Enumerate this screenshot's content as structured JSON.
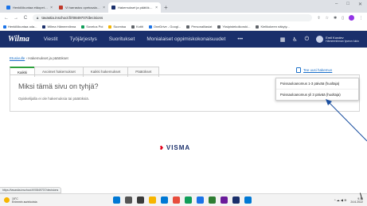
{
  "browser": {
    "tabs": [
      {
        "title": "Henkilökuntaa etäopetus ja oppimi...",
        "color": "#1a73e8"
      },
      {
        "title": "Vi harrastus opetusalaltaan (P)...",
        "color": "#c0392b"
      },
      {
        "title": "Hakemukset ja päätökset - Wilm...",
        "color": "#1a2f6b",
        "active": true
      }
    ],
    "new_tab_icon": "+",
    "window_controls": [
      "–",
      "□",
      "✕"
    ],
    "nav": {
      "back": "←",
      "forward": "→",
      "reload": "C"
    },
    "url": "tavastia.inschool.fi/!0849707/decisions",
    "bookmarks": [
      {
        "label": "Henkilökuntaa oda...",
        "color": "#1a73e8"
      },
      {
        "label": "Wilma Hämeenlinna",
        "color": "#1a2f6b"
      },
      {
        "label": "Sovelus Poi",
        "color": "#0f9d58"
      },
      {
        "label": "Suomisa",
        "color": "#f4b400"
      },
      {
        "label": "Kotiti",
        "color": "#5f6368"
      },
      {
        "label": "OneDrive - Googl...",
        "color": "#1a73e8"
      },
      {
        "label": "Personalliasiat",
        "color": "#5f6368"
      },
      {
        "label": "Yksipistekolkoroki...",
        "color": "#5f6368"
      },
      {
        "label": "Kielikokeen näkyty...",
        "color": "#5f6368"
      }
    ]
  },
  "app": {
    "logo": "Wilma",
    "nav": [
      "Viestit",
      "Työjärjestys",
      "Suoritukset",
      "Monialaiset oppimiskokonaisuudet",
      "•••"
    ],
    "user_name": "Emil Korolev",
    "user_subtitle": "Hämeenlinnan lyseon lukio"
  },
  "content": {
    "breadcrumb_link": "Etusivulle",
    "breadcrumb_current": "› Hakemukset ja päätökset",
    "tabs": [
      "Kaikki",
      "Avoimet hakemukset",
      "Kaikki hakemukset",
      "Päätökset"
    ],
    "new_application": "Tee uusi hakemus",
    "empty_title": "Miksi tämä sivu on tyhjä?",
    "empty_sub": "Opiskelijalla ei ole hakemuksia tai päätöksiä.",
    "dropdown_items": [
      "Poissaoloanomus 1-3 päivää (huoltaja)",
      "Poissaoloanomus yli 3 päivää (huoltaja)"
    ],
    "footer_brand": "VISMA",
    "status_url": "https://tavastia.inschool.fi/!0849707/decisions"
  },
  "taskbar": {
    "weather_temp": "15°C",
    "weather_desc": "Enimmin aurinkoista",
    "time": "9.08",
    "date": "24.6.2022",
    "tray": "^ ☁ ◀ ≋",
    "icons": [
      "#0078d4",
      "#555555",
      "#3a3a3a",
      "#f7b500",
      "#0078d4",
      "#e74c3c",
      "#0f9d58",
      "#1a73e8",
      "#2e7d32",
      "#6a1b9a",
      "#1a2f6b",
      "#0078d4"
    ]
  },
  "overlay": {
    "cursor_char": "\\"
  }
}
